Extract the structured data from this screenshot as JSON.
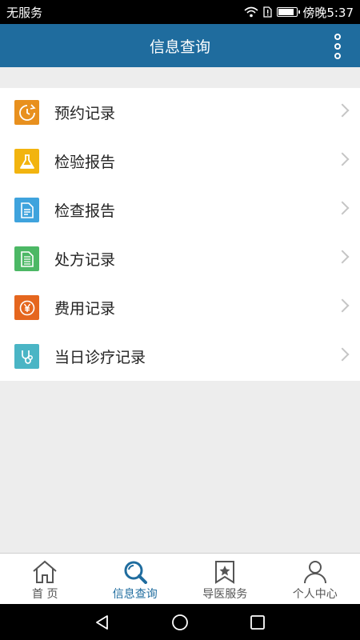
{
  "status_bar": {
    "carrier": "无服务",
    "time": "傍晚5:37",
    "battery_level": 0.85
  },
  "app_bar": {
    "title": "信息查询"
  },
  "menu": {
    "items": [
      {
        "label": "预约记录",
        "icon": "clock-refresh-icon",
        "color": "#e8901e"
      },
      {
        "label": "检验报告",
        "icon": "flask-icon",
        "color": "#f2b40f"
      },
      {
        "label": "检查报告",
        "icon": "document-icon",
        "color": "#3fa3dd"
      },
      {
        "label": "处方记录",
        "icon": "prescription-icon",
        "color": "#4cb865"
      },
      {
        "label": "费用记录",
        "icon": "yen-icon",
        "color": "#e5661e"
      },
      {
        "label": "当日诊疗记录",
        "icon": "stethoscope-icon",
        "color": "#4ab5c5"
      }
    ]
  },
  "tabs": [
    {
      "label": "首 页",
      "icon": "home-icon",
      "active": false
    },
    {
      "label": "信息查询",
      "icon": "search-icon",
      "active": true
    },
    {
      "label": "导医服务",
      "icon": "bookmark-star-icon",
      "active": false
    },
    {
      "label": "个人中心",
      "icon": "user-icon",
      "active": false
    }
  ],
  "colors": {
    "primary": "#1f6c9e",
    "background": "#ededed"
  }
}
